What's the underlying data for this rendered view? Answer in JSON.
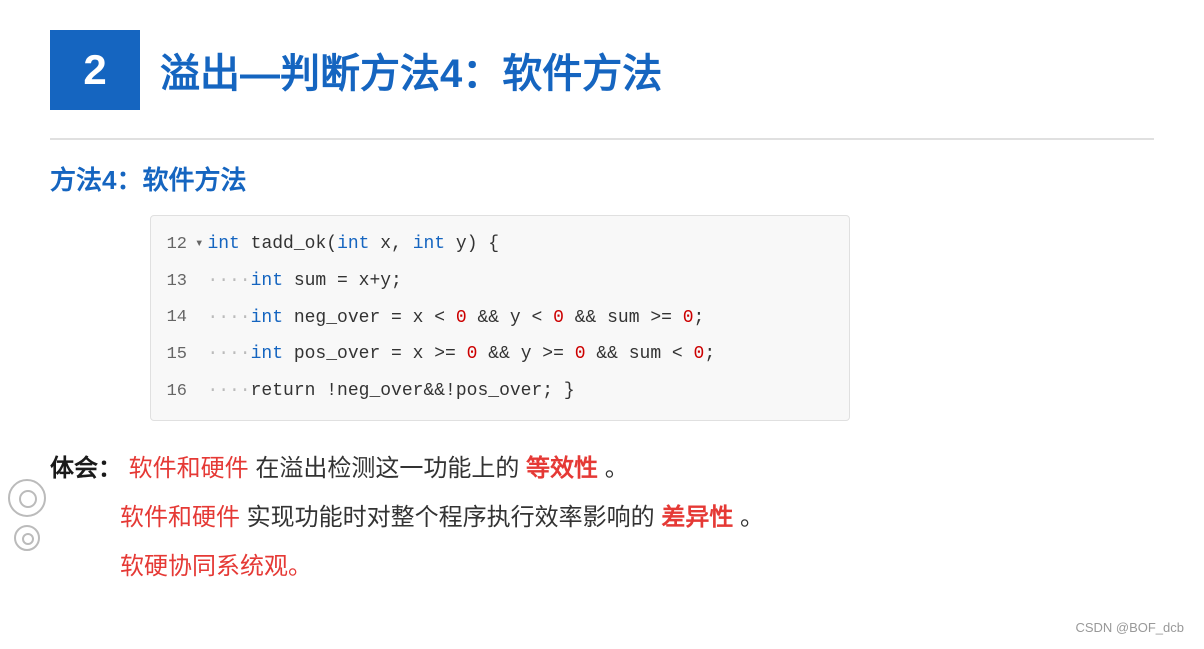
{
  "header": {
    "number": "2",
    "title": "溢出—判断方法4：软件方法"
  },
  "section": {
    "label": "方法4：软件方法"
  },
  "code": {
    "lines": [
      {
        "number": "12",
        "has_arrow": true,
        "content": "int tadd_ok(int x, int y) {"
      },
      {
        "number": "13",
        "has_arrow": false,
        "content": "····int sum = x+y;"
      },
      {
        "number": "14",
        "has_arrow": false,
        "content": "····int neg_over = x < 0 && y < 0 && sum >= 0;"
      },
      {
        "number": "15",
        "has_arrow": false,
        "content": "····int pos_over = x >= 0 && y >= 0 && sum < 0;"
      },
      {
        "number": "16",
        "has_arrow": false,
        "content": "····return !neg_over&&!pos_over; }"
      }
    ]
  },
  "body": {
    "label": "体会：",
    "line1_part1": "软件和硬件",
    "line1_part2": "在溢出检测这一功能上的",
    "line1_part3": "等效性",
    "line1_part4": "。",
    "line2_part1": "软件和硬件",
    "line2_part2": "实现功能时对整个程序执行效率影响的",
    "line2_part3": "差异性",
    "line2_part4": "。",
    "line3": "软硬协同系统观。"
  },
  "watermark": "CSDN @BOF_dcb"
}
